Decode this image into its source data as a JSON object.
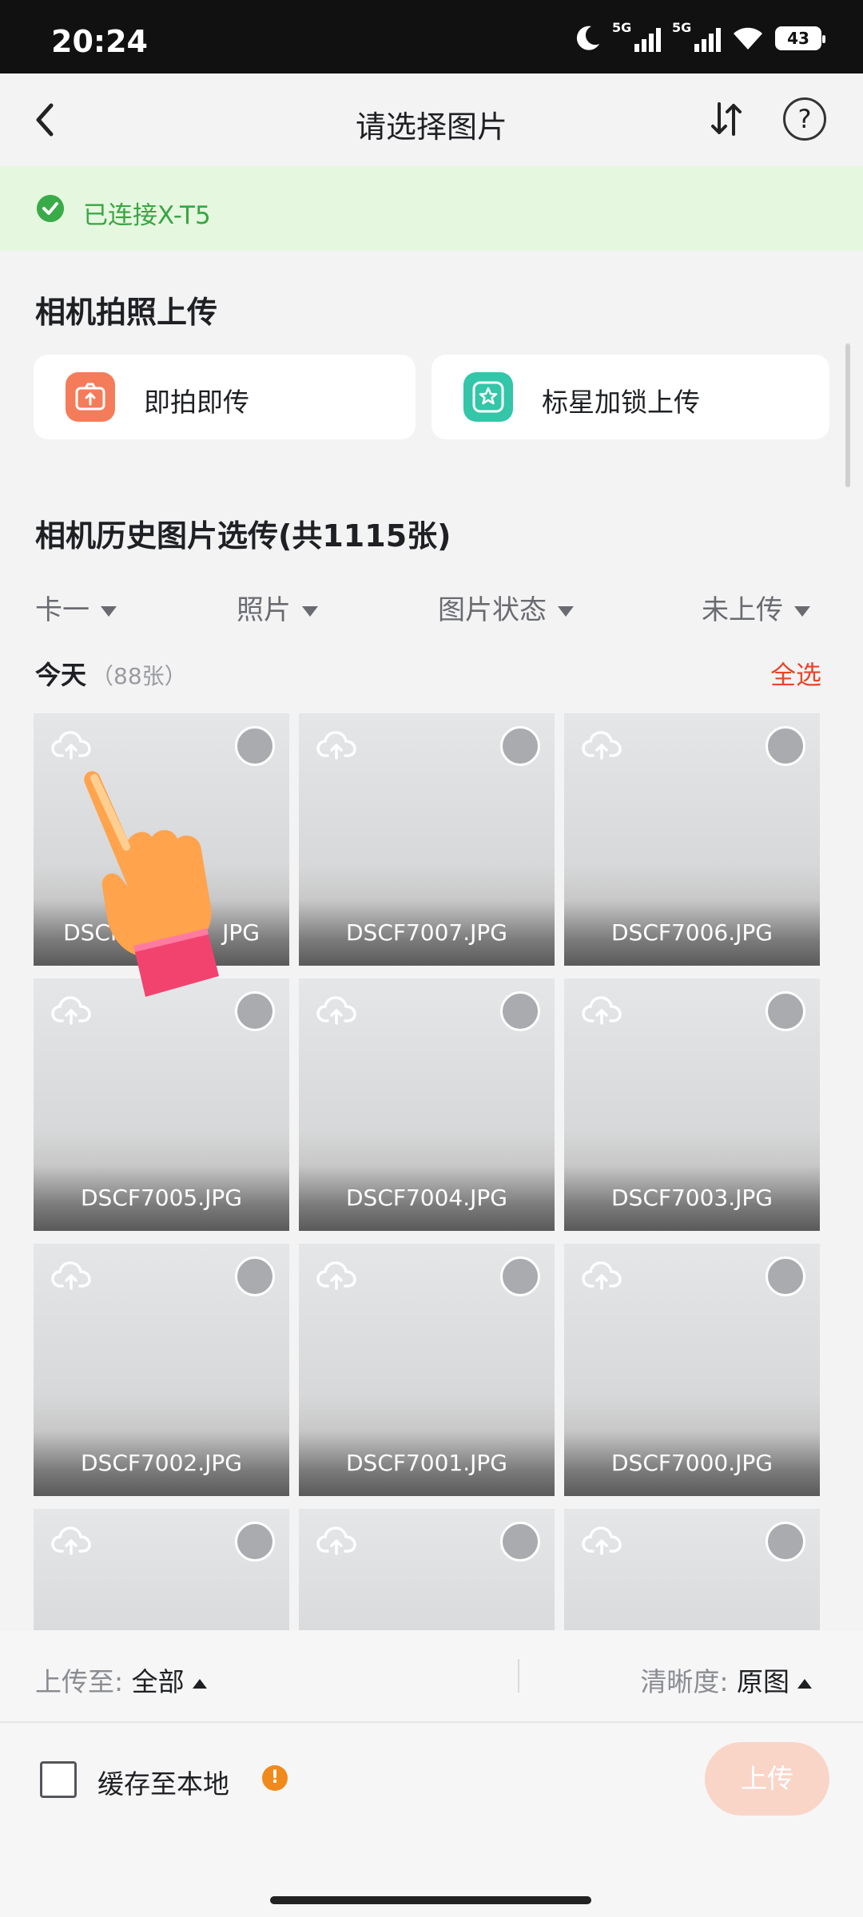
{
  "status_bar": {
    "time": "20:24",
    "network_1": "5G",
    "network_2": "5G",
    "battery": "43"
  },
  "header": {
    "title": "请选择图片"
  },
  "connection": {
    "text": "已连接X-T5",
    "color": "#3aa544"
  },
  "camera_upload": {
    "title": "相机拍照上传",
    "cards": [
      {
        "label": "即拍即传",
        "icon": "camera-upload-icon",
        "color": "#f47c5a"
      },
      {
        "label": "标星加锁上传",
        "icon": "star-lock-icon",
        "color": "#33c6a8"
      }
    ]
  },
  "history": {
    "title": "相机历史图片选传(共1115张)",
    "filters": [
      "卡一",
      "照片",
      "图片状态",
      "未上传"
    ],
    "day_label": "今天",
    "day_count": "（88张）",
    "select_all": "全选",
    "select_all_color": "#e8452c",
    "photos": [
      "",
      "DSCF7007.JPG",
      "DSCF7006.JPG",
      "DSCF7005.JPG",
      "DSCF7004.JPG",
      "DSCF7003.JPG",
      "DSCF7002.JPG",
      "DSCF7001.JPG",
      "DSCF7000.JPG",
      "",
      "",
      ""
    ],
    "first_photo_visible_parts": [
      "DSCF",
      "JPG"
    ]
  },
  "bottom": {
    "upload_to_label": "上传至:",
    "upload_to_value": "全部",
    "clarity_label": "清晰度:",
    "clarity_value": "原图",
    "cache_label": "缓存至本地",
    "cache_checked": false,
    "warn_icon": "!",
    "upload_button": "上传",
    "upload_button_color": "#f9d5c8"
  }
}
